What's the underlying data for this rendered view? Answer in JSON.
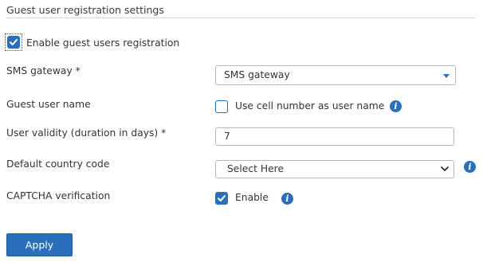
{
  "section": {
    "title": "Guest user registration settings"
  },
  "enable_registration": {
    "label": "Enable guest users registration",
    "checked": true
  },
  "sms_gateway": {
    "label": "SMS gateway *",
    "value": "SMS gateway"
  },
  "guest_user_name": {
    "label": "Guest user name",
    "option_label": "Use cell number as user name",
    "checked": false
  },
  "user_validity": {
    "label": "User validity (duration in days) *",
    "value": "7"
  },
  "country_code": {
    "label": "Default country code",
    "value": "Select Here"
  },
  "captcha": {
    "label": "CAPTCHA verification",
    "option_label": "Enable",
    "checked": true
  },
  "icons": {
    "info": "info-icon",
    "check": "check-icon",
    "dropdown_caret": "caret-down-icon",
    "dropdown_chevron": "chevron-down-icon"
  },
  "colors": {
    "accent": "#2a6fba",
    "border": "#b8b8b8",
    "text": "#333333"
  },
  "actions": {
    "apply_label": "Apply"
  }
}
